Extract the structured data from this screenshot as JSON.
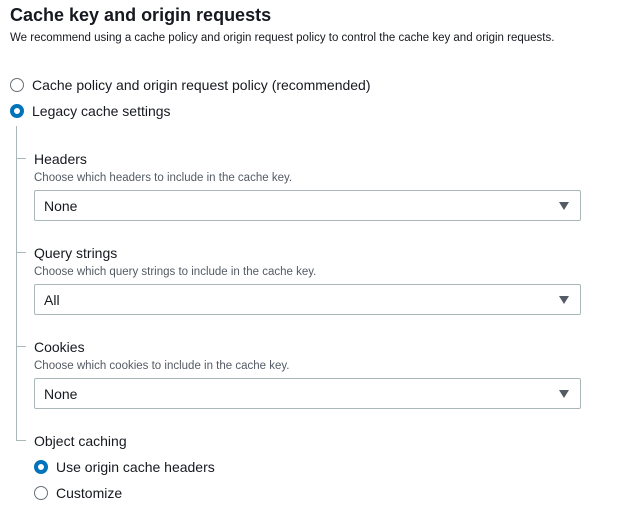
{
  "section": {
    "title": "Cache key and origin requests",
    "description": "We recommend using a cache policy and origin request policy to control the cache key and origin requests."
  },
  "cache_mode": {
    "options": [
      {
        "label": "Cache policy and origin request policy (recommended)",
        "checked": false
      },
      {
        "label": "Legacy cache settings",
        "checked": true
      }
    ]
  },
  "headers": {
    "label": "Headers",
    "description": "Choose which headers to include in the cache key.",
    "value": "None"
  },
  "query_strings": {
    "label": "Query strings",
    "description": "Choose which query strings to include in the cache key.",
    "value": "All"
  },
  "cookies": {
    "label": "Cookies",
    "description": "Choose which cookies to include in the cache key.",
    "value": "None"
  },
  "object_caching": {
    "label": "Object caching",
    "options": [
      {
        "label": "Use origin cache headers",
        "checked": true
      },
      {
        "label": "Customize",
        "checked": false
      }
    ]
  },
  "colors": {
    "accent": "#0073bb",
    "text": "#16191f",
    "secondary_text": "#545b64",
    "border": "#aab7b8"
  }
}
